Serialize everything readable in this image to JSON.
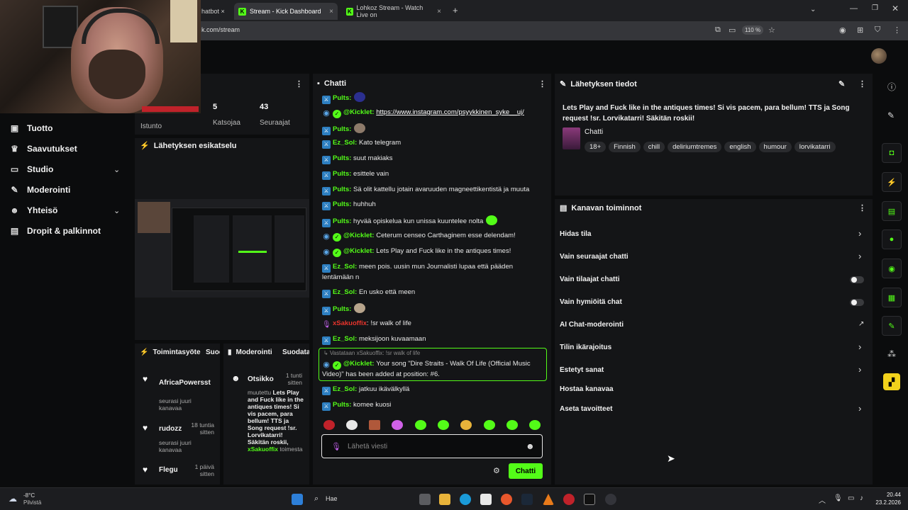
{
  "browser": {
    "tabs": [
      {
        "label": "hatbot ×"
      },
      {
        "label": "Stream - Kick Dashboard",
        "close": "×"
      },
      {
        "label": "Lohkoz Stream - Watch Live on",
        "close": "×"
      }
    ],
    "new_tab": "+",
    "url": "k.com/stream",
    "zoom": "110 %"
  },
  "sidebar": {
    "items": [
      {
        "label": "Tuotto",
        "icon": "wallet-icon"
      },
      {
        "label": "Saavutukset",
        "icon": "trophy-icon"
      },
      {
        "label": "Studio",
        "icon": "monitor-icon"
      },
      {
        "label": "Moderointi",
        "icon": "wrench-icon"
      },
      {
        "label": "Yhteisö",
        "icon": "people-icon"
      },
      {
        "label": "Dropit & palkinnot",
        "icon": "gift-icon"
      }
    ]
  },
  "stats": {
    "session_label": "Istunto",
    "viewers": "5",
    "viewers_label": "Katsojaa",
    "followers": "43",
    "followers_label": "Seuraajat"
  },
  "preview": {
    "title": "Lähetyksen esikatselu"
  },
  "chat": {
    "title": "Chatti",
    "messages": [
      {
        "user": "Pults",
        "text": ""
      },
      {
        "user": "@Kicklet",
        "text": "https://www.instagram.com/psyykkinen_syke__uj/"
      },
      {
        "user": "Pults",
        "text": ""
      },
      {
        "user": "Ez_Sol",
        "text": "Kato telegram"
      },
      {
        "user": "Pults",
        "text": "suut makiaks"
      },
      {
        "user": "Pults",
        "text": "esittele vain"
      },
      {
        "user": "Pults",
        "text": "Sä olit kattellu jotain avaruuden magneettikentistä ja muuta"
      },
      {
        "user": "Pults",
        "text": "huhhuh"
      },
      {
        "user": "Pults",
        "text": "hyvää opiskelua kun unissa kuuntelee nolta"
      },
      {
        "user": "@Kicklet",
        "text": "Ceterum censeo Carthaginem esse delendam!"
      },
      {
        "user": "@Kicklet",
        "text": "Lets Play and Fuck like in the antiques times!"
      },
      {
        "user": "Ez_Sol",
        "text": "meen pois. uusin mun Journalisti lupaa että pääden lentämään n"
      },
      {
        "user": "Ez_Sol",
        "text": "En usko että meen"
      },
      {
        "user": "Pults",
        "text": ""
      },
      {
        "user": "xSakuoffix",
        "text": "!sr walk of life"
      },
      {
        "user": "Ez_Sol",
        "text": "meksijoon kuvaamaan"
      }
    ],
    "pinned": {
      "reply_note": "↳ Vastataan xSakuoffix: !sr walk of life",
      "user": "@Kicklet",
      "text": "Your song \"Dire Straits - Walk Of Life (Official Music Video)\" has been added at position: #6."
    },
    "after": [
      {
        "user": "Ez_Sol",
        "text": "jatkuu ikävälkyllä"
      },
      {
        "user": "Pults",
        "text": "komee kuosi"
      }
    ],
    "input_placeholder": "Lähetä viesti",
    "send_label": "Chatti"
  },
  "stream_info": {
    "title": "Lähetyksen tiedot",
    "stream_title": "Lets Play and Fuck like in the antiques times! Si vis pacem, para bellum! TTS ja Song request !sr. Lorvikatarri! Säkitän roskii!",
    "category": "Chatti",
    "tags": [
      "18+",
      "Finnish",
      "chill",
      "deliriumtremes",
      "english",
      "humour",
      "lorvikatarri"
    ]
  },
  "channel_actions": {
    "title": "Kanavan toiminnot",
    "rows": [
      {
        "label": "Hidas tila",
        "control": "chevron"
      },
      {
        "label": "Vain seuraajat chatti",
        "control": "chevron"
      },
      {
        "label": "Vain tilaajat chatti",
        "control": "toggle"
      },
      {
        "label": "Vain hymiöitä chat",
        "control": "toggle"
      },
      {
        "label": "AI Chat-moderointi",
        "control": "external"
      },
      {
        "label": "Tilin ikärajoitus",
        "control": "chevron"
      },
      {
        "label": "Estetyt sanat",
        "control": "chevron"
      },
      {
        "label": "Hostaa kanavaa",
        "control": "none"
      },
      {
        "label": "Aseta tavoitteet",
        "control": "chevron"
      }
    ]
  },
  "activity": {
    "title": "Toimintasyöte",
    "title_cut": "Suod",
    "items": [
      {
        "name": "AfricaPowersst",
        "sub": "seurasi juuri kanavaa",
        "time": ""
      },
      {
        "name": "rudozz",
        "sub": "seurasi juuri kanavaa",
        "time": "18 tuntia sitten"
      },
      {
        "name": "Flegu",
        "sub": "",
        "time": "1 päivä sitten"
      }
    ]
  },
  "moderation": {
    "title": "Moderointi",
    "title_cut": "Suodata",
    "item_title": "Otsikko",
    "item_time": "1 tunti sitten",
    "item_body_prefix": "muutettu",
    "item_body": "Lets Play and Fuck like in the antiques times! Si vis pacem, para bellum! TTS ja Song request !sr. Lorvikatarri! Säkitän roskii,",
    "item_user": "xSakuoffix",
    "item_suffix": "toimesta"
  },
  "taskbar": {
    "weather_temp": "-8°C",
    "weather_desc": "Pilvistä",
    "search_label": "Hae",
    "time": "20.44",
    "date": "23.2.2026"
  },
  "colors": {
    "accent": "#53fc18",
    "panel": "#141517",
    "bg": "#0b0c0d"
  }
}
